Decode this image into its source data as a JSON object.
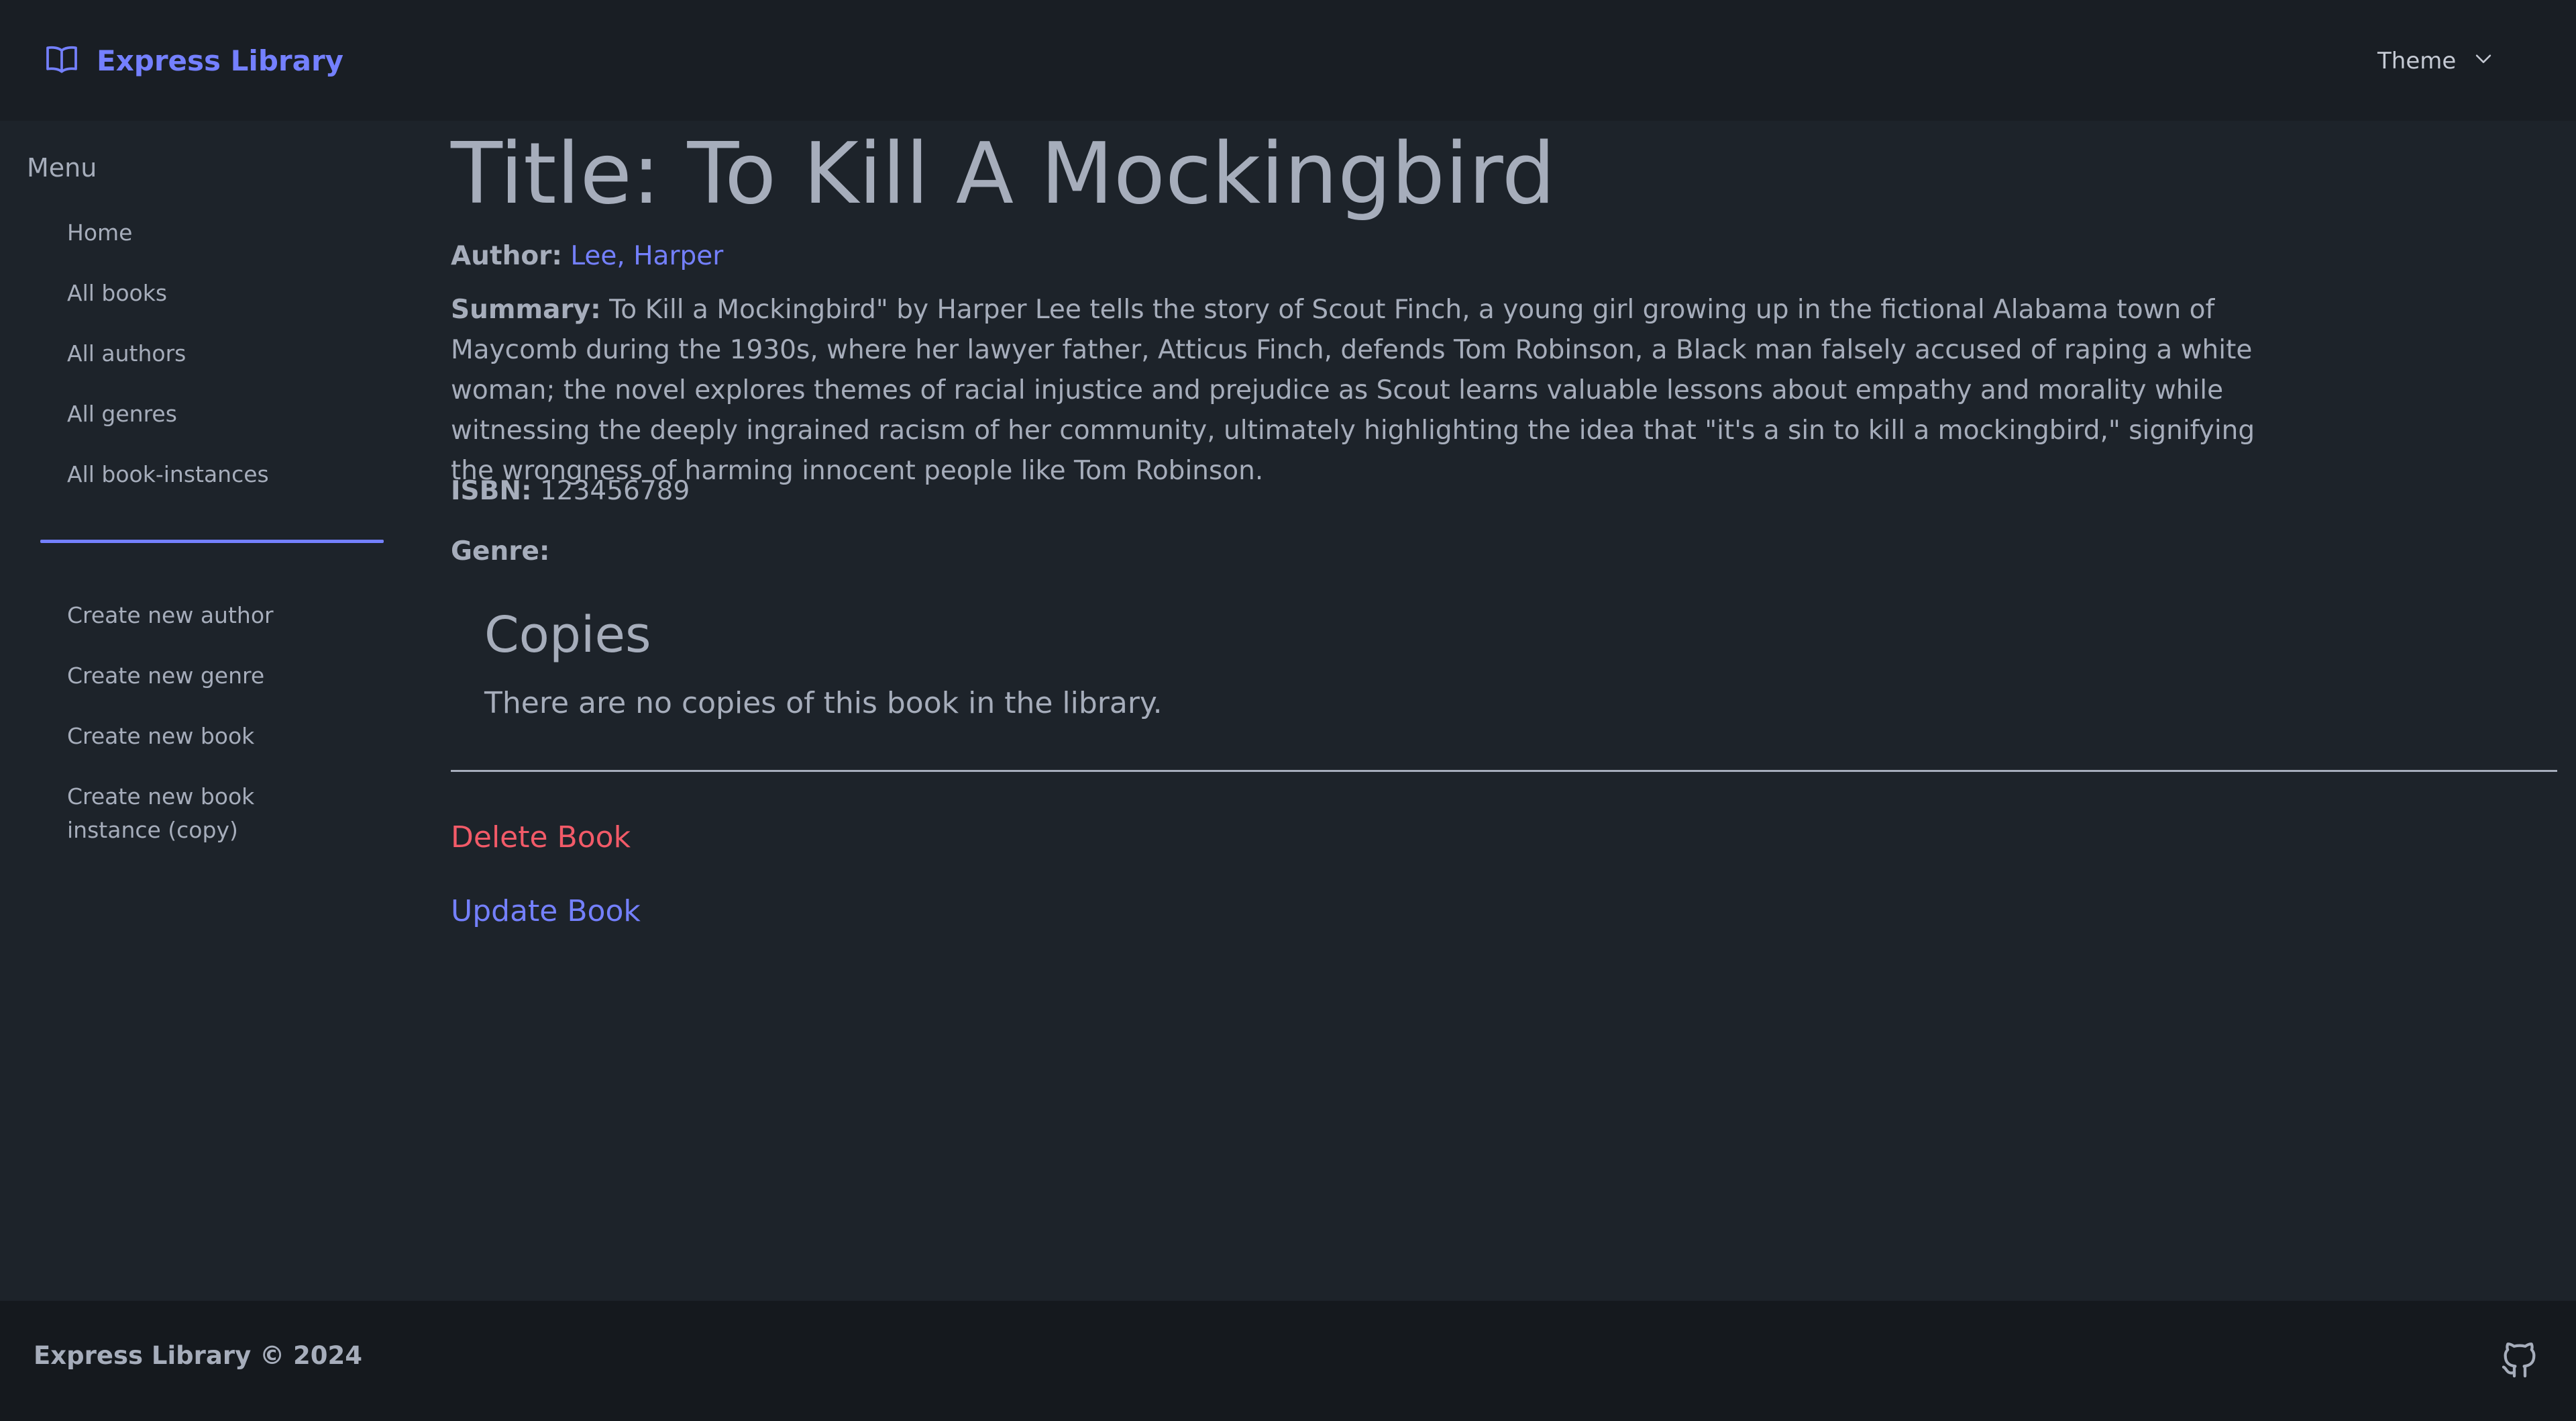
{
  "header": {
    "brand_name": "Express Library",
    "theme_label": "Theme",
    "accent_color": "#7480ff"
  },
  "sidebar": {
    "menu_title": "Menu",
    "items": [
      {
        "label": "Home"
      },
      {
        "label": "All books"
      },
      {
        "label": "All authors"
      },
      {
        "label": "All genres"
      },
      {
        "label": "All book-instances"
      }
    ],
    "create_items": [
      {
        "label": "Create new author"
      },
      {
        "label": "Create new genre"
      },
      {
        "label": "Create new book"
      },
      {
        "label": "Create new book instance (copy)"
      }
    ]
  },
  "book": {
    "title": "Title: To Kill A Mockingbird",
    "author_label": "Author:",
    "author_name": "Lee, Harper",
    "summary_label": "Summary:",
    "summary_text": "To Kill a Mockingbird\" by Harper Lee tells the story of Scout Finch, a young girl growing up in the fictional Alabama town of Maycomb during the 1930s, where her lawyer father, Atticus Finch, defends Tom Robinson, a Black man falsely accused of raping a white woman; the novel explores themes of racial injustice and prejudice as Scout learns valuable lessons about empathy and morality while witnessing the deeply ingrained racism of her community, ultimately highlighting the idea that \"it's a sin to kill a mockingbird,\" signifying the wrongness of harming innocent people like Tom Robinson.",
    "isbn_label": "ISBN:",
    "isbn_value": "123456789",
    "genre_label": "Genre:",
    "genre_value": ""
  },
  "copies": {
    "heading": "Copies",
    "empty_message": "There are no copies of this book in the library."
  },
  "actions": {
    "delete_label": "Delete Book",
    "delete_color": "#f25a68",
    "update_label": "Update Book"
  },
  "footer": {
    "text": "Express Library © 2024",
    "github_icon": "github-icon"
  },
  "icons": {
    "brand": "book-open-icon",
    "theme": "chevron-down-icon"
  }
}
